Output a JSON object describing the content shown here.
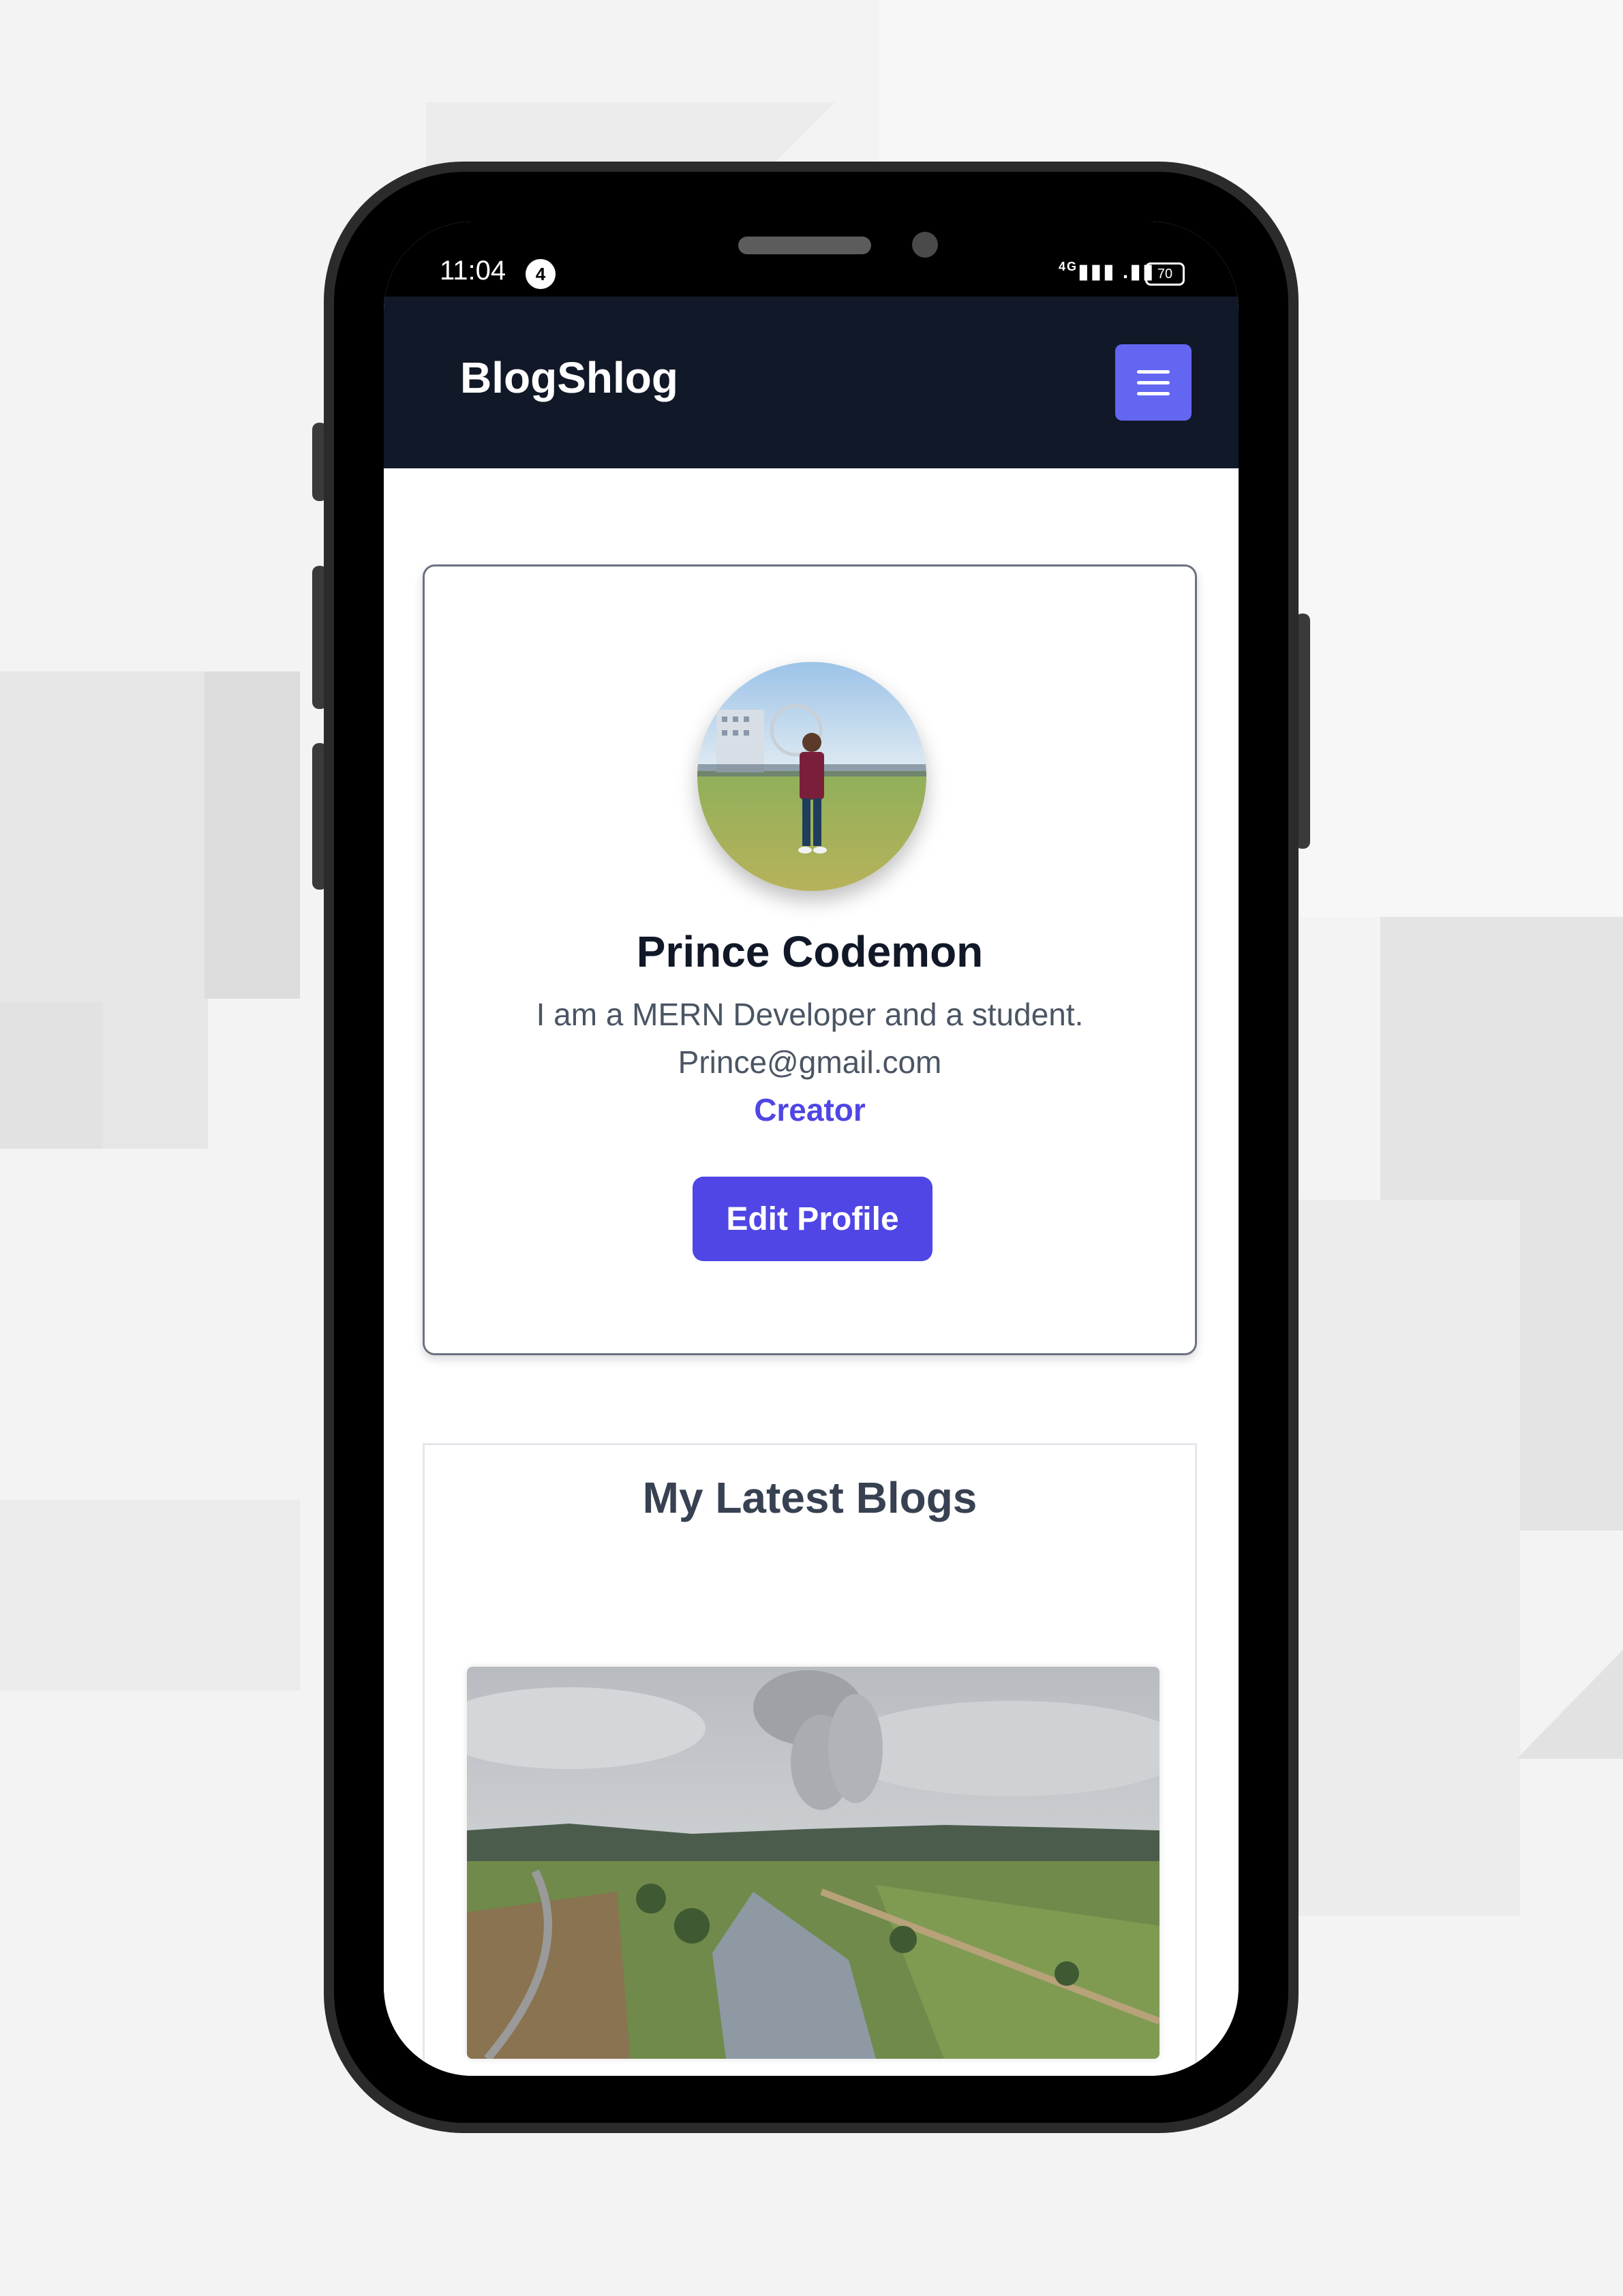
{
  "status_bar": {
    "time": "11:04",
    "notification_count": "4",
    "signal": "4G",
    "battery": "70"
  },
  "navbar": {
    "brand": "BlogShlog",
    "menu_icon": "hamburger-menu-icon"
  },
  "profile": {
    "name": "Prince Codemon",
    "bio": "I am a MERN Developer and a student.",
    "email": "Prince@gmail.com",
    "role": "Creator",
    "edit_button_label": "Edit Profile"
  },
  "blogs": {
    "section_title": "My Latest Blogs"
  },
  "colors": {
    "navbar_bg": "#111827",
    "accent": "#6366f1",
    "button": "#4f46e5"
  }
}
